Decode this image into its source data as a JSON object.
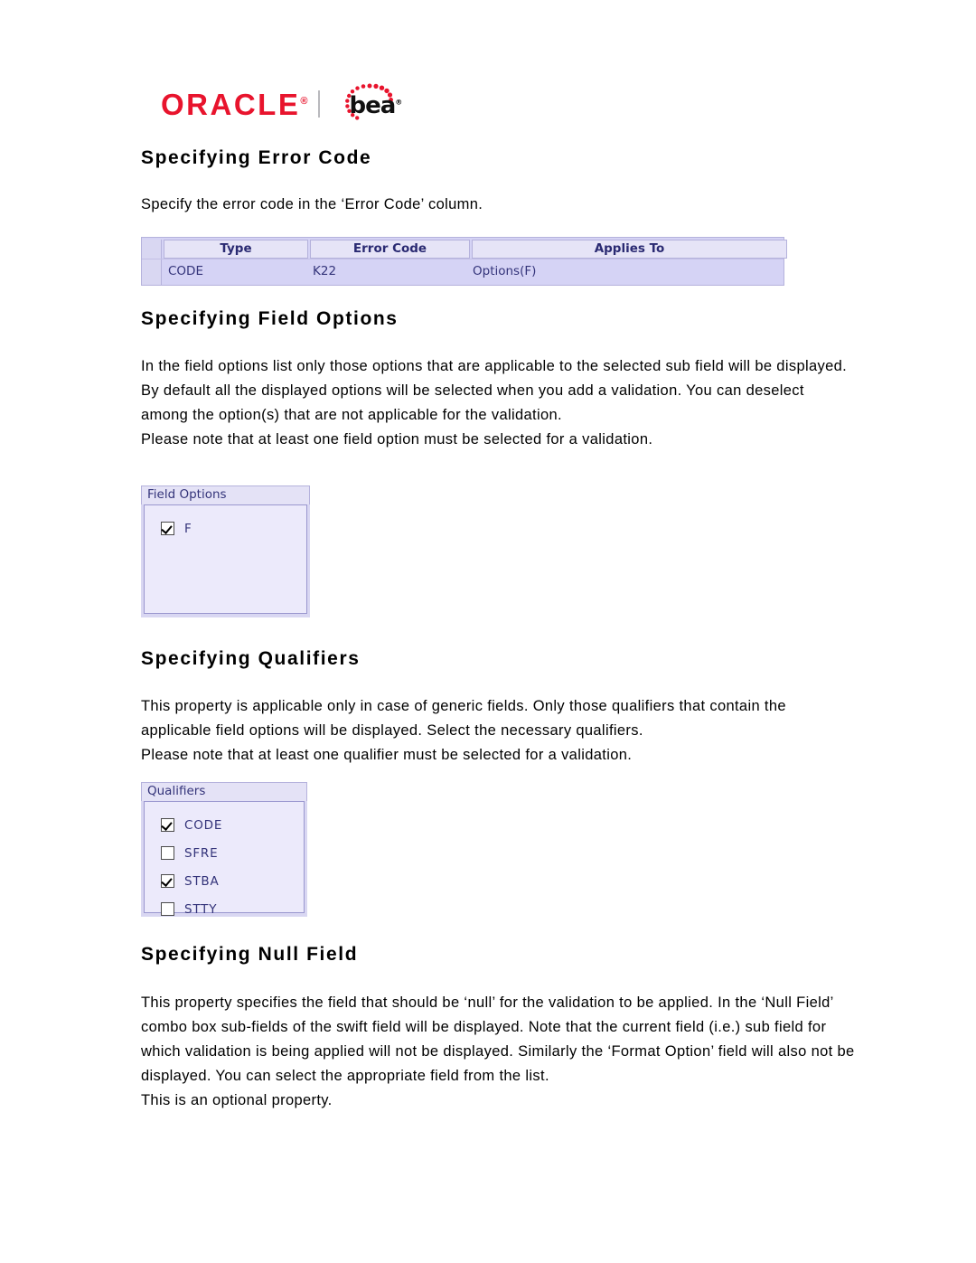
{
  "logo": {
    "oracle_text": "ORACLE",
    "oracle_reg": "®",
    "bea_text": "bea",
    "bea_reg": "®",
    "brand_red": "#e8142d",
    "bea_black": "#111111"
  },
  "sections": [
    {
      "title": "Specifying Error Code",
      "paragraphs": [
        "Specify the error code in the ‘Error Code’ column."
      ]
    },
    {
      "title": "Specifying Field Options",
      "paragraphs": [
        "In the field options list only those options that are applicable to the selected sub field will be displayed. By default all the displayed options will be selected when you add a validation. You can deselect among the option(s) that are not applicable for the validation.",
        "Please note that at least one field option must be selected for a validation."
      ]
    },
    {
      "title": "Specifying Qualifiers",
      "paragraphs": [
        "This property is applicable only in case of generic fields. Only those qualifiers that contain the applicable field options will be displayed. Select the necessary qualifiers.",
        "Please note that at least one qualifier must be selected for a validation."
      ]
    },
    {
      "title": "Specifying Null Field",
      "paragraphs": [
        "This property specifies the field that should be ‘null’ for the validation to be applied. In the ‘Null Field’ combo box sub-fields of the swift field will be displayed. Note that the current field (i.e.) sub field for which validation is being applied will not be displayed. Similarly the ‘Format Option’ field will also not be displayed. You can select the appropriate field from the list.",
        "This is an optional property."
      ]
    }
  ],
  "error_code_table": {
    "columns": [
      "Type",
      "Error Code",
      "Applies To"
    ],
    "rows": [
      {
        "type": "CODE",
        "error_code": "K22",
        "applies_to": "Options(F)"
      }
    ],
    "header_bg": "#e6e4f7",
    "row_bg": "#d5d3f5",
    "text_color": "#34347a"
  },
  "field_options_panel": {
    "title": "Field Options",
    "options": [
      {
        "label": "F",
        "checked": true
      }
    ]
  },
  "qualifiers_panel": {
    "title": "Qualifiers",
    "options": [
      {
        "label": "CODE",
        "checked": true
      },
      {
        "label": "SFRE",
        "checked": false
      },
      {
        "label": "STBA",
        "checked": true
      },
      {
        "label": "STTY",
        "checked": false
      }
    ]
  }
}
